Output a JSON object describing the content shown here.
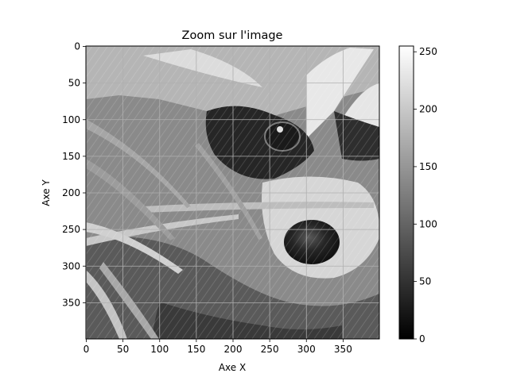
{
  "chart_data": {
    "type": "heatmap",
    "title": "Zoom sur l'image",
    "xlabel": "Axe X",
    "ylabel": "Axe Y",
    "xlim": [
      0,
      400
    ],
    "ylim": [
      400,
      0
    ],
    "x_ticks": [
      0,
      50,
      100,
      150,
      200,
      250,
      300,
      350
    ],
    "y_ticks": [
      0,
      50,
      100,
      150,
      200,
      250,
      300,
      350
    ],
    "grid": true,
    "colormap": "gray",
    "colorbar": {
      "min": 0,
      "max": 255,
      "ticks": [
        0,
        50,
        100,
        150,
        200,
        250
      ]
    },
    "image_content": "grayscale close-up of a raccoon face with grass"
  }
}
